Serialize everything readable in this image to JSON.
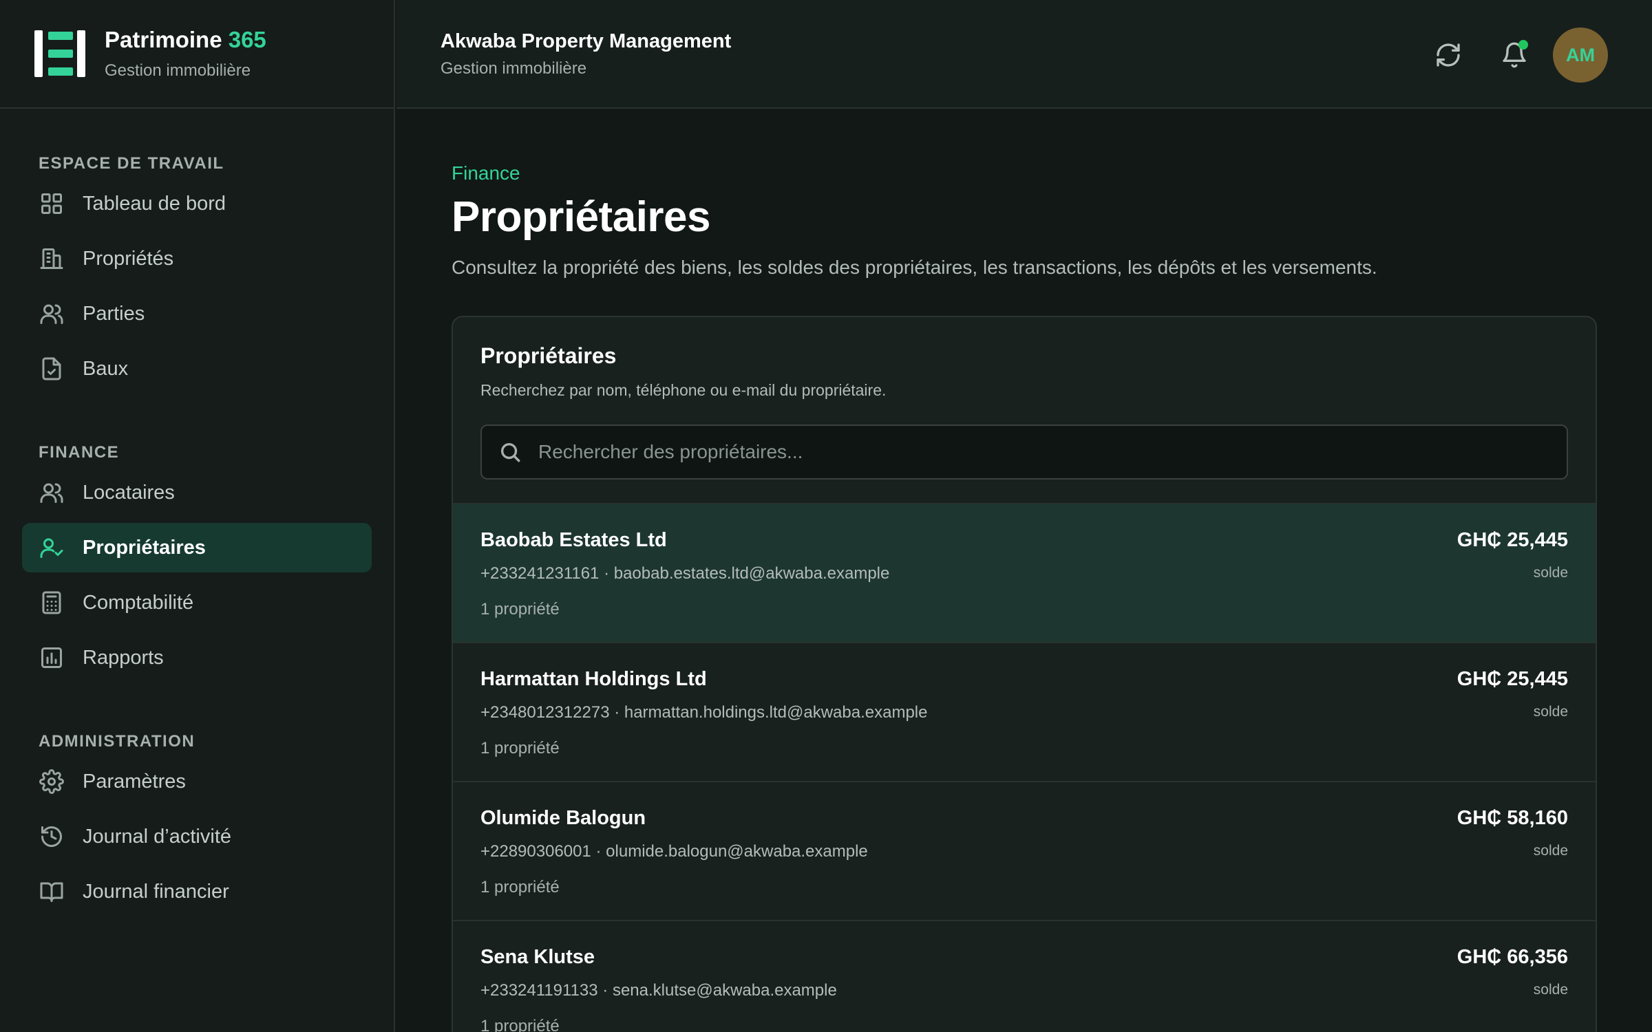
{
  "brand": {
    "name": "Patrimoine",
    "name_accent": "365",
    "subtitle": "Gestion immobilière"
  },
  "header": {
    "org_name": "Akwaba Property Management",
    "org_subtitle": "Gestion immobilière",
    "avatar_initials": "AM"
  },
  "sidebar": {
    "sections": [
      {
        "heading": "ESPACE DE TRAVAIL",
        "items": [
          {
            "label": "Tableau de bord",
            "icon": "grid-icon"
          },
          {
            "label": "Propriétés",
            "icon": "building-icon"
          },
          {
            "label": "Parties",
            "icon": "users-icon"
          },
          {
            "label": "Baux",
            "icon": "file-check-icon"
          }
        ]
      },
      {
        "heading": "FINANCE",
        "items": [
          {
            "label": "Locataires",
            "icon": "users-icon"
          },
          {
            "label": "Propriétaires",
            "icon": "user-check-icon",
            "active": true
          },
          {
            "label": "Comptabilité",
            "icon": "calculator-icon"
          },
          {
            "label": "Rapports",
            "icon": "bar-chart-icon"
          }
        ]
      },
      {
        "heading": "ADMINISTRATION",
        "items": [
          {
            "label": "Paramètres",
            "icon": "gear-icon"
          },
          {
            "label": "Journal d’activité",
            "icon": "history-icon"
          },
          {
            "label": "Journal financier",
            "icon": "book-icon"
          }
        ]
      }
    ]
  },
  "main": {
    "breadcrumb": "Finance",
    "title": "Propriétaires",
    "description": "Consultez la propriété des biens, les soldes des propriétaires, les transactions, les dépôts et les versements.",
    "card": {
      "title": "Propriétaires",
      "subtitle": "Recherchez par nom, téléphone ou e-mail du propriétaire.",
      "search_placeholder": "Rechercher des propriétaires..."
    },
    "owners": [
      {
        "name": "Baobab Estates Ltd",
        "contact": "+233241231161 · baobab.estates.ltd@akwaba.example",
        "properties": "1 propriété",
        "balance": "GH₵ 25,445",
        "balance_label": "solde",
        "selected": true
      },
      {
        "name": "Harmattan Holdings Ltd",
        "contact": "+2348012312273 · harmattan.holdings.ltd@akwaba.example",
        "properties": "1 propriété",
        "balance": "GH₵ 25,445",
        "balance_label": "solde"
      },
      {
        "name": "Olumide Balogun",
        "contact": "+22890306001 · olumide.balogun@akwaba.example",
        "properties": "1 propriété",
        "balance": "GH₵ 58,160",
        "balance_label": "solde"
      },
      {
        "name": "Sena Klutse",
        "contact": "+233241191133 · sena.klutse@akwaba.example",
        "properties": "1 propriété",
        "balance": "GH₵ 66,356",
        "balance_label": "solde"
      }
    ]
  },
  "colors": {
    "accent": "#34d399",
    "background": "#111816",
    "selected_row": "#1d3630"
  }
}
